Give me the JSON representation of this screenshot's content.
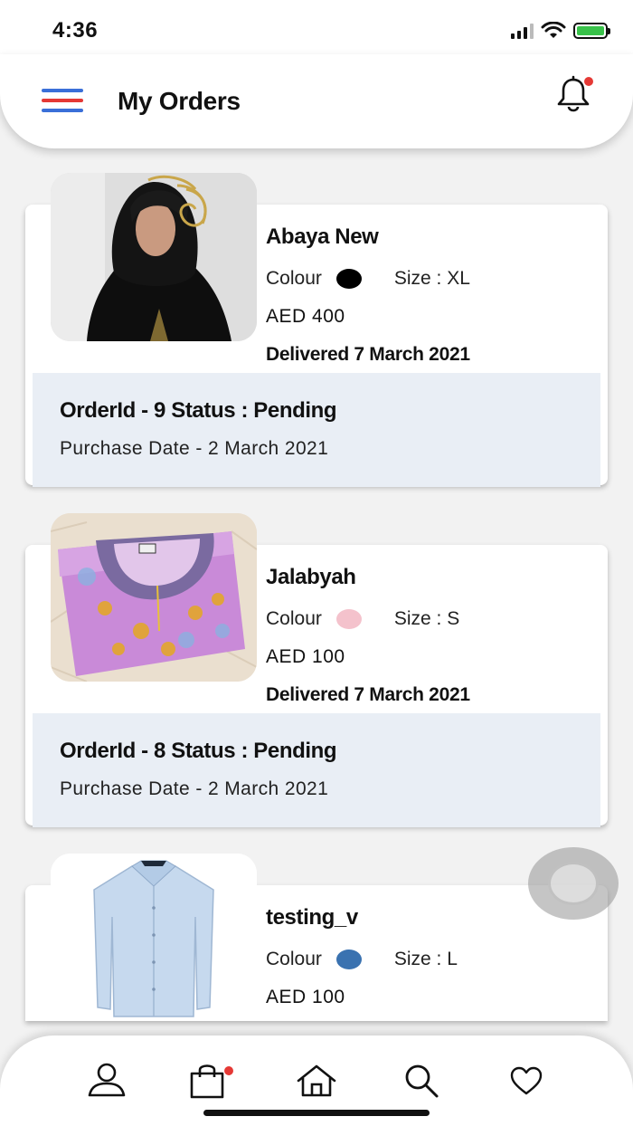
{
  "status_bar": {
    "time": "4:36",
    "battery_color": "#39c24a"
  },
  "header": {
    "title": "My Orders",
    "menu_colors": [
      "#3a6fd8",
      "#e53935",
      "#3a6fd8"
    ],
    "notification_badge_color": "#e53935"
  },
  "labels": {
    "colour": "Colour",
    "size_prefix": "Size : "
  },
  "orders": [
    {
      "name": "Abaya New",
      "colour": "#000000",
      "size": "XL",
      "price": "AED 400",
      "delivered": "Delivered 7 March 2021",
      "order_line": "OrderId - 9  Status : Pending",
      "purchase_date": "Purchase Date - 2 March 2021",
      "image": "abaya-photo"
    },
    {
      "name": "Jalabyah",
      "colour": "#f4c2cc",
      "size": "S",
      "price": "AED 100",
      "delivered": "Delivered 7 March 2021",
      "order_line": "OrderId - 8  Status : Pending",
      "purchase_date": "Purchase Date - 2 March 2021",
      "image": "jalabiya-photo"
    },
    {
      "name": "testing_v",
      "colour": "#3a72b0",
      "size": "L",
      "price": "AED 100",
      "image": "shirt-photo"
    }
  ],
  "bottom_nav": {
    "items": [
      "profile-icon",
      "cart-icon",
      "home-icon",
      "search-icon",
      "heart-icon"
    ],
    "cart_badge_color": "#e53935"
  }
}
